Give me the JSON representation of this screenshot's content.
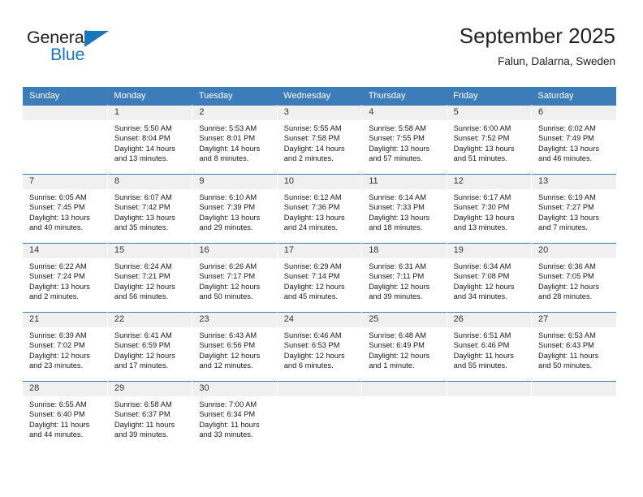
{
  "brand": {
    "name_top": "General",
    "name_bottom": "Blue",
    "accent_color": "#1b75bb",
    "triangle_icon": "triangle-icon"
  },
  "header": {
    "title": "September 2025",
    "subtitle": "Falun, Dalarna, Sweden"
  },
  "colors": {
    "header_row_bg": "#3c7cb8",
    "daynum_bg": "#f0f0f0",
    "cell_bg": "#ffffff",
    "text": "#1a1a1a"
  },
  "weekday_headers": [
    "Sunday",
    "Monday",
    "Tuesday",
    "Wednesday",
    "Thursday",
    "Friday",
    "Saturday"
  ],
  "weeks": [
    [
      {
        "day": "",
        "sunrise": "",
        "sunset": "",
        "daylight": "",
        "daylight2": ""
      },
      {
        "day": "1",
        "sunrise": "Sunrise: 5:50 AM",
        "sunset": "Sunset: 8:04 PM",
        "daylight": "Daylight: 14 hours",
        "daylight2": "and 13 minutes."
      },
      {
        "day": "2",
        "sunrise": "Sunrise: 5:53 AM",
        "sunset": "Sunset: 8:01 PM",
        "daylight": "Daylight: 14 hours",
        "daylight2": "and 8 minutes."
      },
      {
        "day": "3",
        "sunrise": "Sunrise: 5:55 AM",
        "sunset": "Sunset: 7:58 PM",
        "daylight": "Daylight: 14 hours",
        "daylight2": "and 2 minutes."
      },
      {
        "day": "4",
        "sunrise": "Sunrise: 5:58 AM",
        "sunset": "Sunset: 7:55 PM",
        "daylight": "Daylight: 13 hours",
        "daylight2": "and 57 minutes."
      },
      {
        "day": "5",
        "sunrise": "Sunrise: 6:00 AM",
        "sunset": "Sunset: 7:52 PM",
        "daylight": "Daylight: 13 hours",
        "daylight2": "and 51 minutes."
      },
      {
        "day": "6",
        "sunrise": "Sunrise: 6:02 AM",
        "sunset": "Sunset: 7:49 PM",
        "daylight": "Daylight: 13 hours",
        "daylight2": "and 46 minutes."
      }
    ],
    [
      {
        "day": "7",
        "sunrise": "Sunrise: 6:05 AM",
        "sunset": "Sunset: 7:45 PM",
        "daylight": "Daylight: 13 hours",
        "daylight2": "and 40 minutes."
      },
      {
        "day": "8",
        "sunrise": "Sunrise: 6:07 AM",
        "sunset": "Sunset: 7:42 PM",
        "daylight": "Daylight: 13 hours",
        "daylight2": "and 35 minutes."
      },
      {
        "day": "9",
        "sunrise": "Sunrise: 6:10 AM",
        "sunset": "Sunset: 7:39 PM",
        "daylight": "Daylight: 13 hours",
        "daylight2": "and 29 minutes."
      },
      {
        "day": "10",
        "sunrise": "Sunrise: 6:12 AM",
        "sunset": "Sunset: 7:36 PM",
        "daylight": "Daylight: 13 hours",
        "daylight2": "and 24 minutes."
      },
      {
        "day": "11",
        "sunrise": "Sunrise: 6:14 AM",
        "sunset": "Sunset: 7:33 PM",
        "daylight": "Daylight: 13 hours",
        "daylight2": "and 18 minutes."
      },
      {
        "day": "12",
        "sunrise": "Sunrise: 6:17 AM",
        "sunset": "Sunset: 7:30 PM",
        "daylight": "Daylight: 13 hours",
        "daylight2": "and 13 minutes."
      },
      {
        "day": "13",
        "sunrise": "Sunrise: 6:19 AM",
        "sunset": "Sunset: 7:27 PM",
        "daylight": "Daylight: 13 hours",
        "daylight2": "and 7 minutes."
      }
    ],
    [
      {
        "day": "14",
        "sunrise": "Sunrise: 6:22 AM",
        "sunset": "Sunset: 7:24 PM",
        "daylight": "Daylight: 13 hours",
        "daylight2": "and 2 minutes."
      },
      {
        "day": "15",
        "sunrise": "Sunrise: 6:24 AM",
        "sunset": "Sunset: 7:21 PM",
        "daylight": "Daylight: 12 hours",
        "daylight2": "and 56 minutes."
      },
      {
        "day": "16",
        "sunrise": "Sunrise: 6:26 AM",
        "sunset": "Sunset: 7:17 PM",
        "daylight": "Daylight: 12 hours",
        "daylight2": "and 50 minutes."
      },
      {
        "day": "17",
        "sunrise": "Sunrise: 6:29 AM",
        "sunset": "Sunset: 7:14 PM",
        "daylight": "Daylight: 12 hours",
        "daylight2": "and 45 minutes."
      },
      {
        "day": "18",
        "sunrise": "Sunrise: 6:31 AM",
        "sunset": "Sunset: 7:11 PM",
        "daylight": "Daylight: 12 hours",
        "daylight2": "and 39 minutes."
      },
      {
        "day": "19",
        "sunrise": "Sunrise: 6:34 AM",
        "sunset": "Sunset: 7:08 PM",
        "daylight": "Daylight: 12 hours",
        "daylight2": "and 34 minutes."
      },
      {
        "day": "20",
        "sunrise": "Sunrise: 6:36 AM",
        "sunset": "Sunset: 7:05 PM",
        "daylight": "Daylight: 12 hours",
        "daylight2": "and 28 minutes."
      }
    ],
    [
      {
        "day": "21",
        "sunrise": "Sunrise: 6:39 AM",
        "sunset": "Sunset: 7:02 PM",
        "daylight": "Daylight: 12 hours",
        "daylight2": "and 23 minutes."
      },
      {
        "day": "22",
        "sunrise": "Sunrise: 6:41 AM",
        "sunset": "Sunset: 6:59 PM",
        "daylight": "Daylight: 12 hours",
        "daylight2": "and 17 minutes."
      },
      {
        "day": "23",
        "sunrise": "Sunrise: 6:43 AM",
        "sunset": "Sunset: 6:56 PM",
        "daylight": "Daylight: 12 hours",
        "daylight2": "and 12 minutes."
      },
      {
        "day": "24",
        "sunrise": "Sunrise: 6:46 AM",
        "sunset": "Sunset: 6:53 PM",
        "daylight": "Daylight: 12 hours",
        "daylight2": "and 6 minutes."
      },
      {
        "day": "25",
        "sunrise": "Sunrise: 6:48 AM",
        "sunset": "Sunset: 6:49 PM",
        "daylight": "Daylight: 12 hours",
        "daylight2": "and 1 minute."
      },
      {
        "day": "26",
        "sunrise": "Sunrise: 6:51 AM",
        "sunset": "Sunset: 6:46 PM",
        "daylight": "Daylight: 11 hours",
        "daylight2": "and 55 minutes."
      },
      {
        "day": "27",
        "sunrise": "Sunrise: 6:53 AM",
        "sunset": "Sunset: 6:43 PM",
        "daylight": "Daylight: 11 hours",
        "daylight2": "and 50 minutes."
      }
    ],
    [
      {
        "day": "28",
        "sunrise": "Sunrise: 6:55 AM",
        "sunset": "Sunset: 6:40 PM",
        "daylight": "Daylight: 11 hours",
        "daylight2": "and 44 minutes."
      },
      {
        "day": "29",
        "sunrise": "Sunrise: 6:58 AM",
        "sunset": "Sunset: 6:37 PM",
        "daylight": "Daylight: 11 hours",
        "daylight2": "and 39 minutes."
      },
      {
        "day": "30",
        "sunrise": "Sunrise: 7:00 AM",
        "sunset": "Sunset: 6:34 PM",
        "daylight": "Daylight: 11 hours",
        "daylight2": "and 33 minutes."
      },
      {
        "day": "",
        "sunrise": "",
        "sunset": "",
        "daylight": "",
        "daylight2": ""
      },
      {
        "day": "",
        "sunrise": "",
        "sunset": "",
        "daylight": "",
        "daylight2": ""
      },
      {
        "day": "",
        "sunrise": "",
        "sunset": "",
        "daylight": "",
        "daylight2": ""
      },
      {
        "day": "",
        "sunrise": "",
        "sunset": "",
        "daylight": "",
        "daylight2": ""
      }
    ]
  ]
}
